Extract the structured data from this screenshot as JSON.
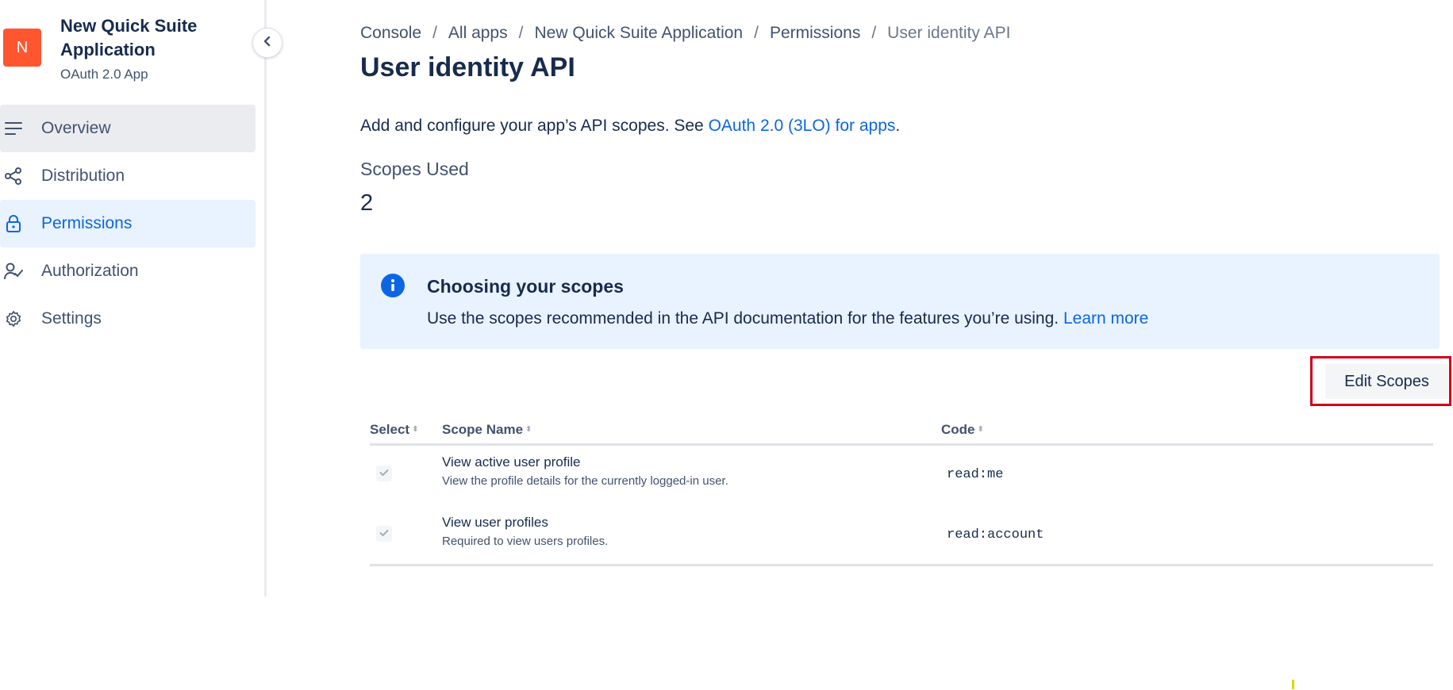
{
  "app": {
    "logo_letter": "N",
    "name": "New Quick Suite Application",
    "type": "OAuth 2.0 App",
    "brand_color": "#ff5630"
  },
  "sidebar": {
    "items": [
      {
        "label": "Overview",
        "icon": "menu-lines-icon",
        "state": "hover"
      },
      {
        "label": "Distribution",
        "icon": "share-icon",
        "state": "normal"
      },
      {
        "label": "Permissions",
        "icon": "lock-icon",
        "state": "active"
      },
      {
        "label": "Authorization",
        "icon": "user-check-icon",
        "state": "normal"
      },
      {
        "label": "Settings",
        "icon": "gear-icon",
        "state": "normal"
      }
    ]
  },
  "breadcrumb": {
    "items": [
      "Console",
      "All apps",
      "New Quick Suite Application",
      "Permissions",
      "User identity API"
    ],
    "separator": "/"
  },
  "page": {
    "title": "User identity API",
    "intro_text": "Add and configure your app’s API scopes. See ",
    "intro_link": "OAuth 2.0 (3LO) for apps",
    "intro_end": ".",
    "scopes_used_label": "Scopes Used",
    "scopes_used_value": "2"
  },
  "info_box": {
    "title": "Choosing your scopes",
    "body": "Use the scopes recommended in the API documentation for the features you’re using. ",
    "link": "Learn more",
    "icon": "info-icon"
  },
  "actions": {
    "edit_scopes_label": "Edit Scopes"
  },
  "table": {
    "columns": [
      "Select",
      "Scope Name",
      "Code"
    ],
    "rows": [
      {
        "name": "View active user profile",
        "description": "View the profile details for the currently logged-in user.",
        "code": "read:me",
        "selected": true
      },
      {
        "name": "View user profiles",
        "description": "Required to view users profiles.",
        "code": "read:account",
        "selected": true
      }
    ]
  },
  "colors": {
    "accent": "#0c66e4",
    "highlight_border": "#d0021b",
    "info_bg": "#e9f2ff"
  }
}
